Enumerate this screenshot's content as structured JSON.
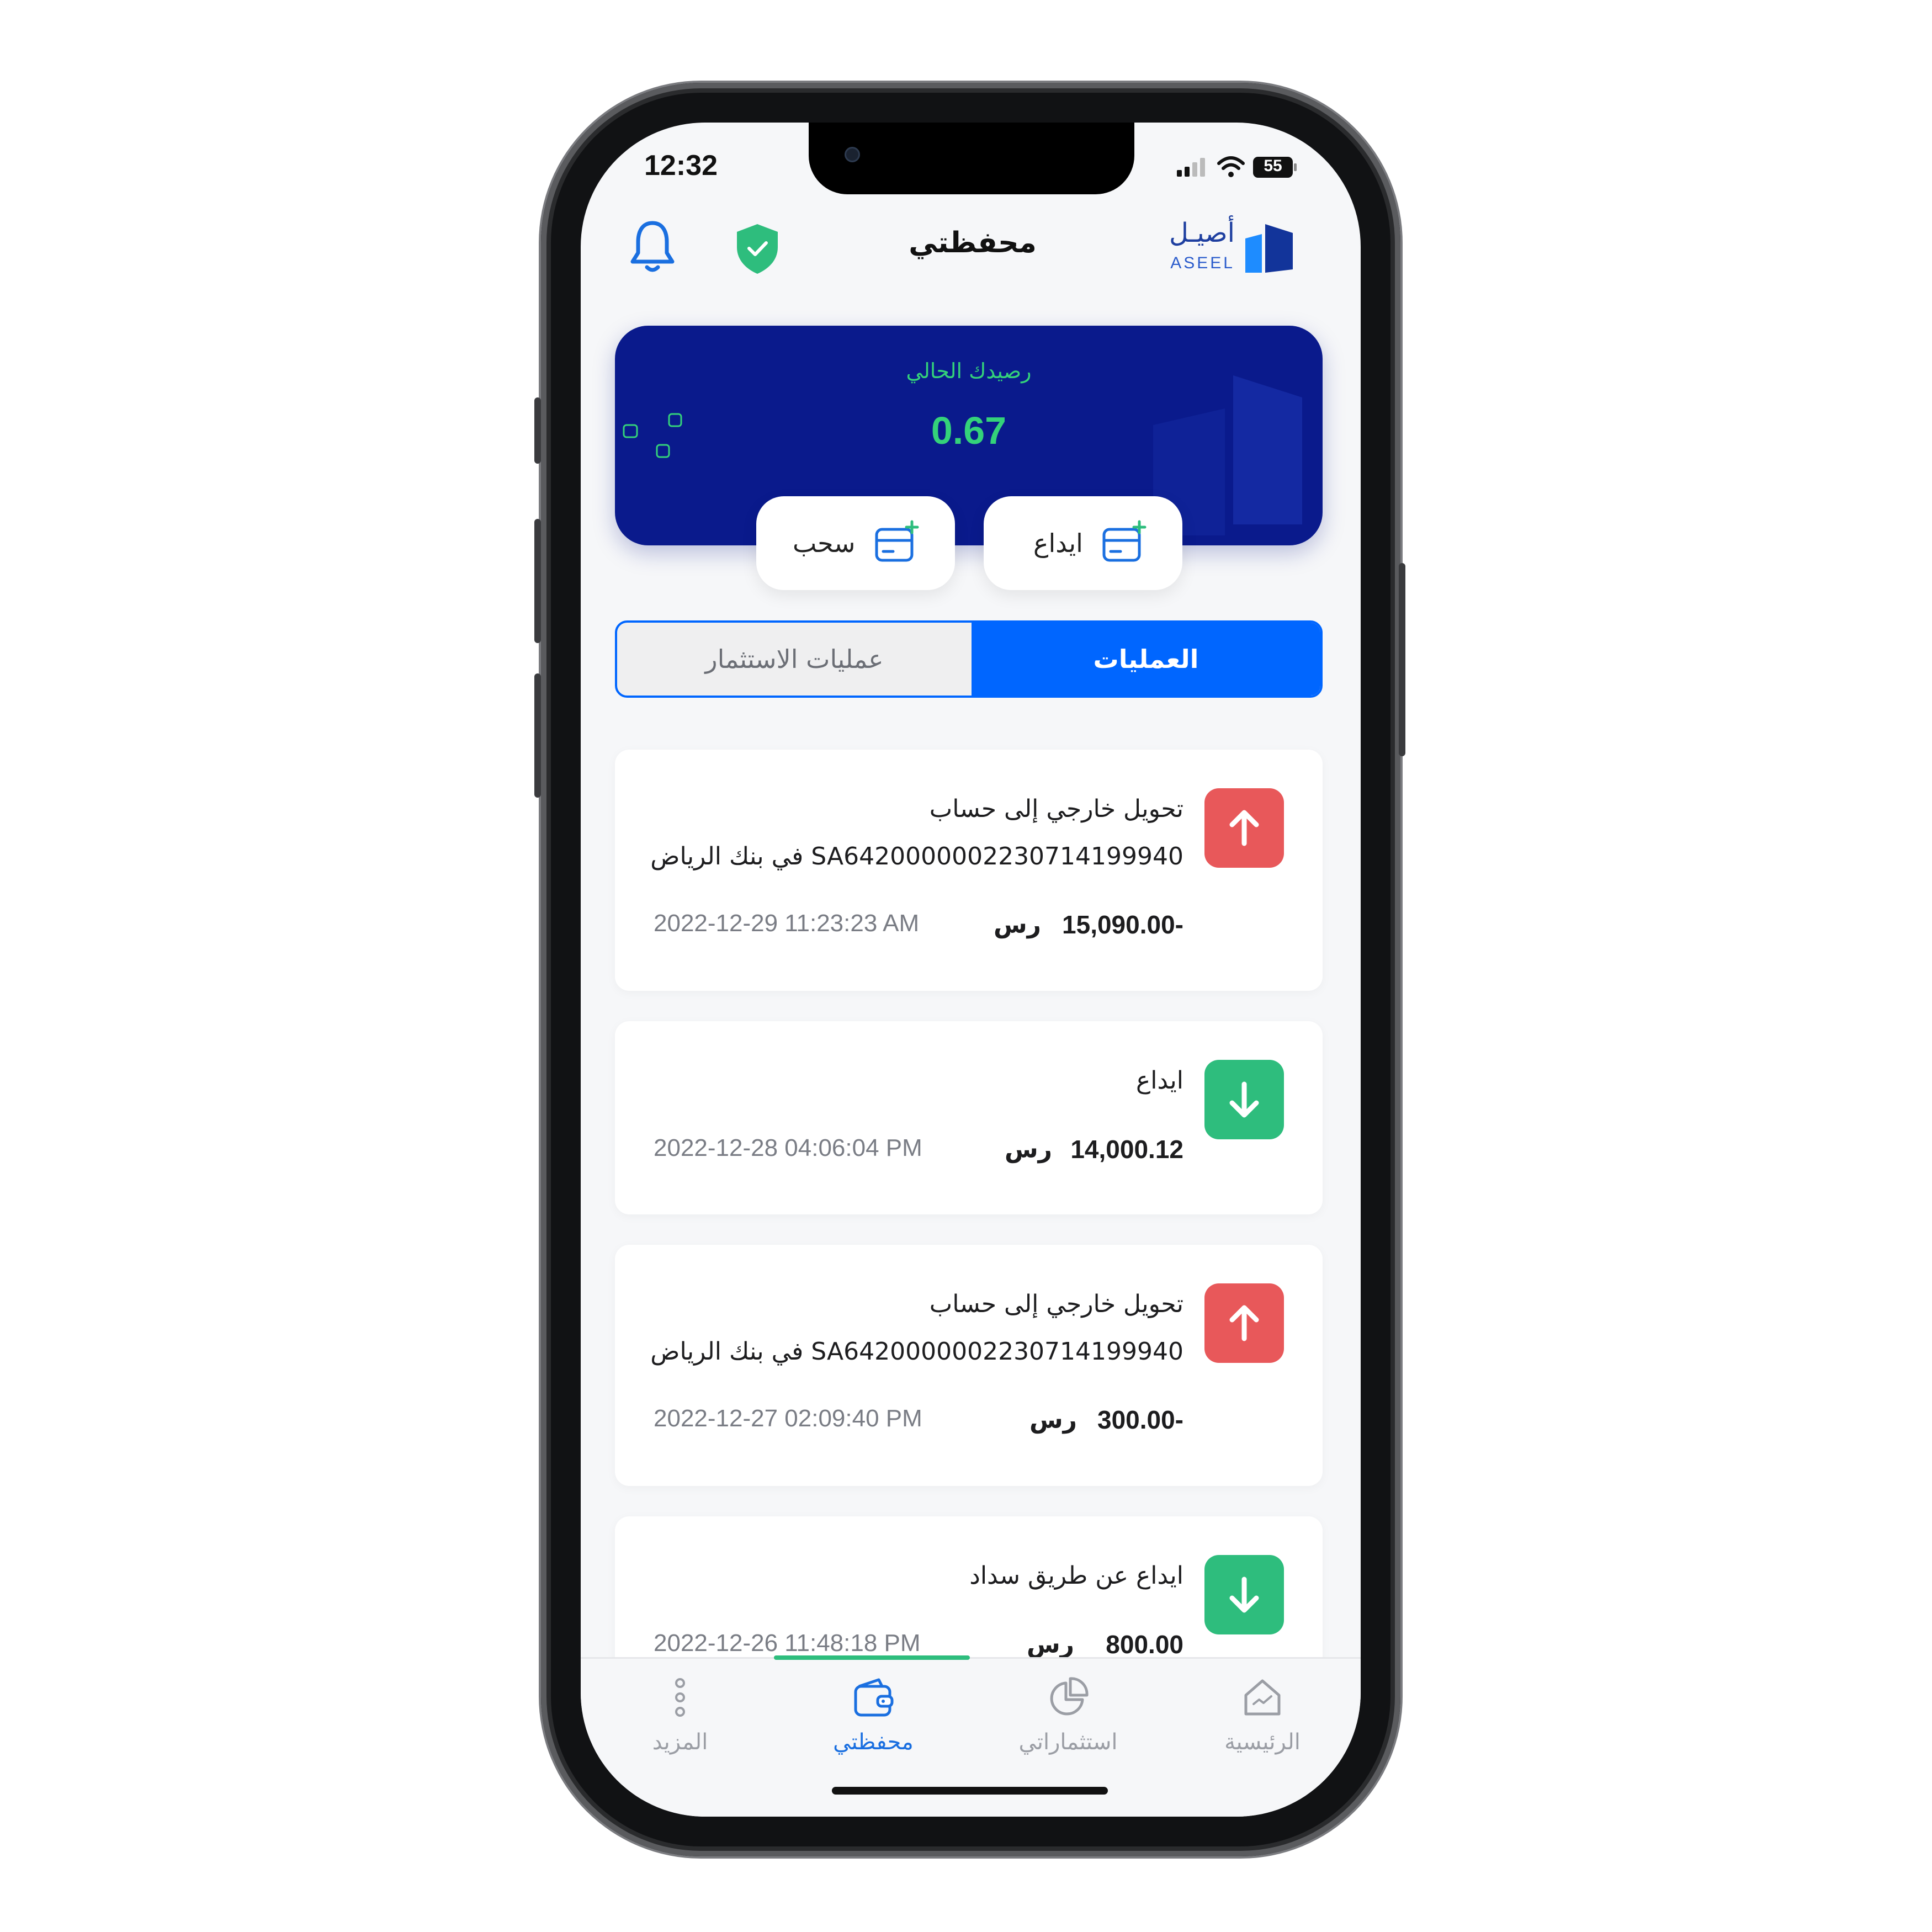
{
  "status_bar": {
    "time": "12:32",
    "battery": "55"
  },
  "header": {
    "title": "محفظتي",
    "logo_ar": "أصيـل",
    "logo_en": "ASEEL"
  },
  "balance": {
    "label": "رصيدك الحالي",
    "value": "0.67"
  },
  "actions": {
    "withdraw_label": "سحب",
    "deposit_label": "ايداع"
  },
  "tabs": {
    "active": "العمليات",
    "inactive": "عمليات الاستثمار"
  },
  "transactions": [
    {
      "type": "out",
      "line1": "تحويل خارجي إلى حساب",
      "line2": "SA6420000002230714199940 في بنك الرياض",
      "amount": "15,090.00-",
      "currency": "رس",
      "date": "2022-12-29 11:23:23 AM"
    },
    {
      "type": "in",
      "line1": "ايداع",
      "amount": "14,000.12",
      "currency": "رس",
      "date": "2022-12-28 04:06:04 PM"
    },
    {
      "type": "out",
      "line1": "تحويل خارجي إلى حساب",
      "line2": "SA6420000002230714199940 في بنك الرياض",
      "amount": "300.00-",
      "currency": "رس",
      "date": "2022-12-27 02:09:40 PM"
    },
    {
      "type": "in",
      "line1": "ايداع عن طريق سداد",
      "amount": "800.00",
      "currency": "رس",
      "date": "2022-12-26 11:48:18 PM"
    }
  ],
  "bottom_nav": {
    "more": "المزيد",
    "wallet": "محفظتي",
    "investments": "استثماراتي",
    "home": "الرئيسية"
  },
  "colors": {
    "brand_blue": "#0a1a8c",
    "accent_blue": "#0066ff",
    "accent_green": "#34d27a",
    "danger_red": "#e8585a",
    "success_green": "#2ebd7d"
  }
}
